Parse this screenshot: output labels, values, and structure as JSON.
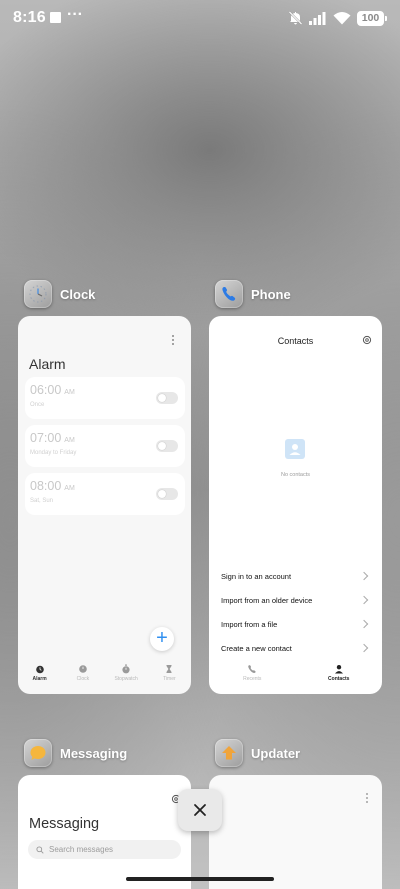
{
  "status_bar": {
    "time": "8:16",
    "more": "···",
    "battery": "100"
  },
  "apps": {
    "clock": {
      "name": "Clock",
      "screen_title": "Alarm",
      "alarms": [
        {
          "time": "06:00",
          "ampm": "AM",
          "sub": "Once",
          "enabled": false
        },
        {
          "time": "07:00",
          "ampm": "AM",
          "sub": "Monday to Friday",
          "enabled": false
        },
        {
          "time": "08:00",
          "ampm": "AM",
          "sub": "Sat, Sun",
          "enabled": false
        }
      ],
      "fab": "+",
      "tabs": [
        "Alarm",
        "Clock",
        "Stopwatch",
        "Timer"
      ],
      "active_tab": "Alarm"
    },
    "phone": {
      "name": "Phone",
      "screen_title": "Contacts",
      "empty_text": "No contacts",
      "options": [
        "Sign in to an account",
        "Import from an older device",
        "Import from a file",
        "Create a new contact"
      ],
      "tabs": [
        "Recents",
        "Contacts"
      ],
      "active_tab": "Contacts"
    },
    "messaging": {
      "name": "Messaging",
      "screen_title": "Messaging",
      "search_placeholder": "Search messages"
    },
    "updater": {
      "name": "Updater"
    }
  },
  "colors": {
    "accent_blue": "#2f8ff0",
    "updater_orange": "#f0a43a",
    "messaging_yellow": "#f5b63d",
    "phone_blue": "#2c7be5"
  },
  "icons": {
    "close_all": "close-icon"
  }
}
